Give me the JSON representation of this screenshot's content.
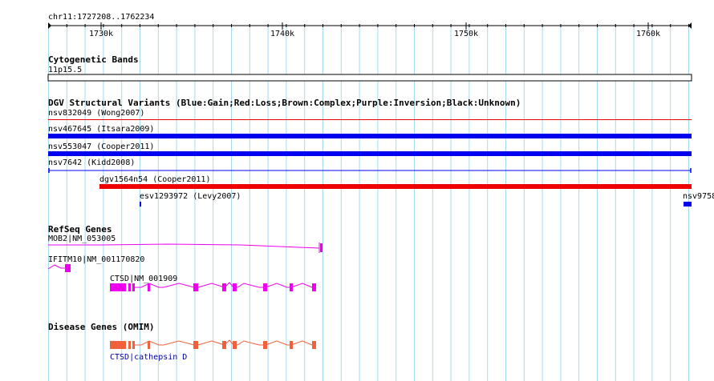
{
  "colors": {
    "grid": "#a8d8ee",
    "gain": "#0000ee",
    "loss": "#ee0000",
    "gene": "#ee00ee",
    "disease": "#f0603a",
    "disease_label": "#0000aa"
  },
  "ruler": {
    "region": "chr11:1727208..1762234",
    "ticks": [
      "1730k",
      "1740k",
      "1750k",
      "1760k"
    ]
  },
  "cytoband": {
    "title": "Cytogenetic Bands",
    "band": "11p15.5"
  },
  "dgv": {
    "title": "DGV Structural Variants (Blue:Gain;Red:Loss;Brown:Complex;Purple:Inversion;Black:Unknown)",
    "variants": [
      {
        "label": "nsv832049 (Wong2007)",
        "type": "loss"
      },
      {
        "label": "nsv467645 (Itsara2009)",
        "type": "gain"
      },
      {
        "label": "nsv553047 (Cooper2011)",
        "type": "gain"
      },
      {
        "label": "nsv7642 (Kidd2008)",
        "type": "gain"
      },
      {
        "label": "dgv1564n54 (Cooper2011)",
        "type": "loss"
      },
      {
        "label": "esv1293972 (Levy2007)",
        "type": "gain"
      },
      {
        "label": "nsv9758",
        "type": "gain"
      }
    ]
  },
  "refseq": {
    "title": "RefSeq Genes",
    "genes": [
      {
        "label": "MOB2|NM_053005"
      },
      {
        "label": "IFITM10|NM_001170820"
      },
      {
        "label": "CTSD|NM_001909"
      }
    ]
  },
  "omim": {
    "title": "Disease Genes (OMIM)",
    "genes": [
      {
        "label": "CTSD|cathepsin D"
      }
    ]
  }
}
